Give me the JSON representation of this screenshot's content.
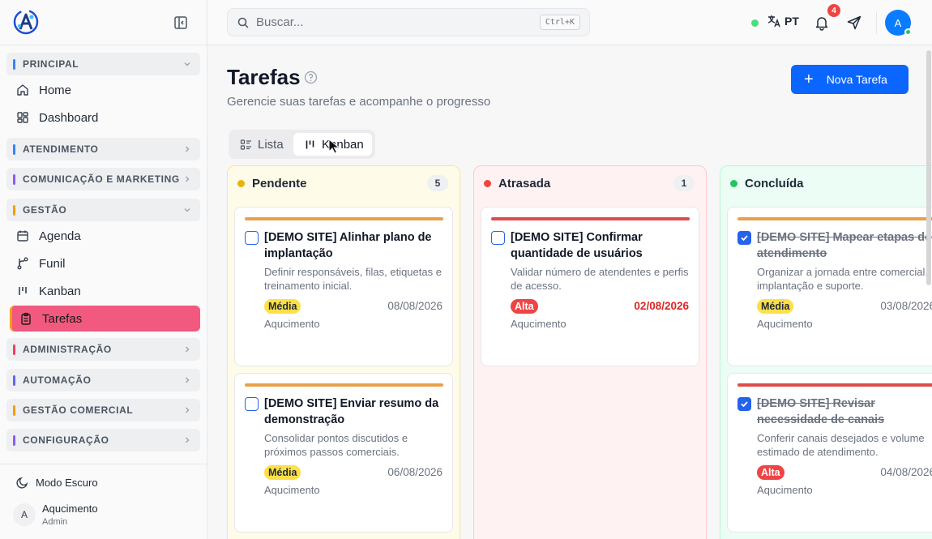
{
  "sidebar": {
    "sections": [
      {
        "title": "PRINCIPAL",
        "color": "#3b82f6"
      },
      {
        "title": "ATENDIMENTO",
        "color": "#3b82f6"
      },
      {
        "title": "COMUNICAÇÃO E MARKETING",
        "color": "#8b5cf6"
      },
      {
        "title": "GESTÃO",
        "color": "#f59e0b"
      },
      {
        "title": "ADMINISTRAÇÃO",
        "color": "#f43f5e"
      },
      {
        "title": "AUTOMAÇÃO",
        "color": "#6366f1"
      },
      {
        "title": "GESTÃO COMERCIAL",
        "color": "#f59e0b"
      },
      {
        "title": "CONFIGURAÇÃO",
        "color": "#8b5cf6"
      }
    ],
    "items": {
      "home": "Home",
      "dashboard": "Dashboard",
      "agenda": "Agenda",
      "funil": "Funil",
      "kanban": "Kanban",
      "tarefas": "Tarefas"
    },
    "dark_mode": "Modo Escuro",
    "user": {
      "initial": "A",
      "name": "Aqucimento",
      "role": "Admin"
    }
  },
  "header": {
    "search_placeholder": "Buscar...",
    "shortcut": "Ctrl+K",
    "language": "PT",
    "notifications": "4",
    "avatar_initial": "A"
  },
  "page": {
    "title": "Tarefas",
    "subtitle": "Gerencie suas tarefas e acompanhe o progresso",
    "new_button": "Nova Tarefa",
    "view_list": "Lista",
    "view_kanban": "Kanban"
  },
  "columns": [
    {
      "title": "Pendente",
      "count": "5",
      "dot": "#eab308",
      "cards": [
        {
          "title": "[DEMO SITE] Alinhar plano de implantação",
          "desc": "Definir responsáveis, filas, etiquetas e treinamento inicial.",
          "priority": "Média",
          "date": "08/08/2026",
          "owner": "Aqucimento",
          "accent": "#e8a04a"
        },
        {
          "title": "[DEMO SITE] Enviar resumo da demonstração",
          "desc": "Consolidar pontos discutidos e próximos passos comerciais.",
          "priority": "Média",
          "date": "06/08/2026",
          "owner": "Aqucimento",
          "accent": "#e8a04a"
        }
      ]
    },
    {
      "title": "Atrasada",
      "count": "1",
      "dot": "#ef4444",
      "cards": [
        {
          "title": "[DEMO SITE] Confirmar quantidade de usuários",
          "desc": "Validar número de atendentes e perfis de acesso.",
          "priority": "Alta",
          "date": "02/08/2026",
          "owner": "Aqucimento",
          "accent": "#dc4d4d"
        }
      ]
    },
    {
      "title": "Concluída",
      "dot": "#22c55e",
      "cards": [
        {
          "title": "[DEMO SITE] Mapear etapas do atendimento",
          "desc": "Organizar a jornada entre comercial, implantação e suporte.",
          "priority": "Média",
          "date": "03/08/2026",
          "owner": "Aqucimento",
          "accent": "#e8a04a"
        },
        {
          "title": "[DEMO SITE] Revisar necessidade de canais",
          "desc": "Conferir canais desejados e volume estimado de atendimento.",
          "priority": "Alta",
          "date": "04/08/2026",
          "owner": "Aqucimento",
          "accent": "#dc4d4d"
        }
      ]
    }
  ]
}
